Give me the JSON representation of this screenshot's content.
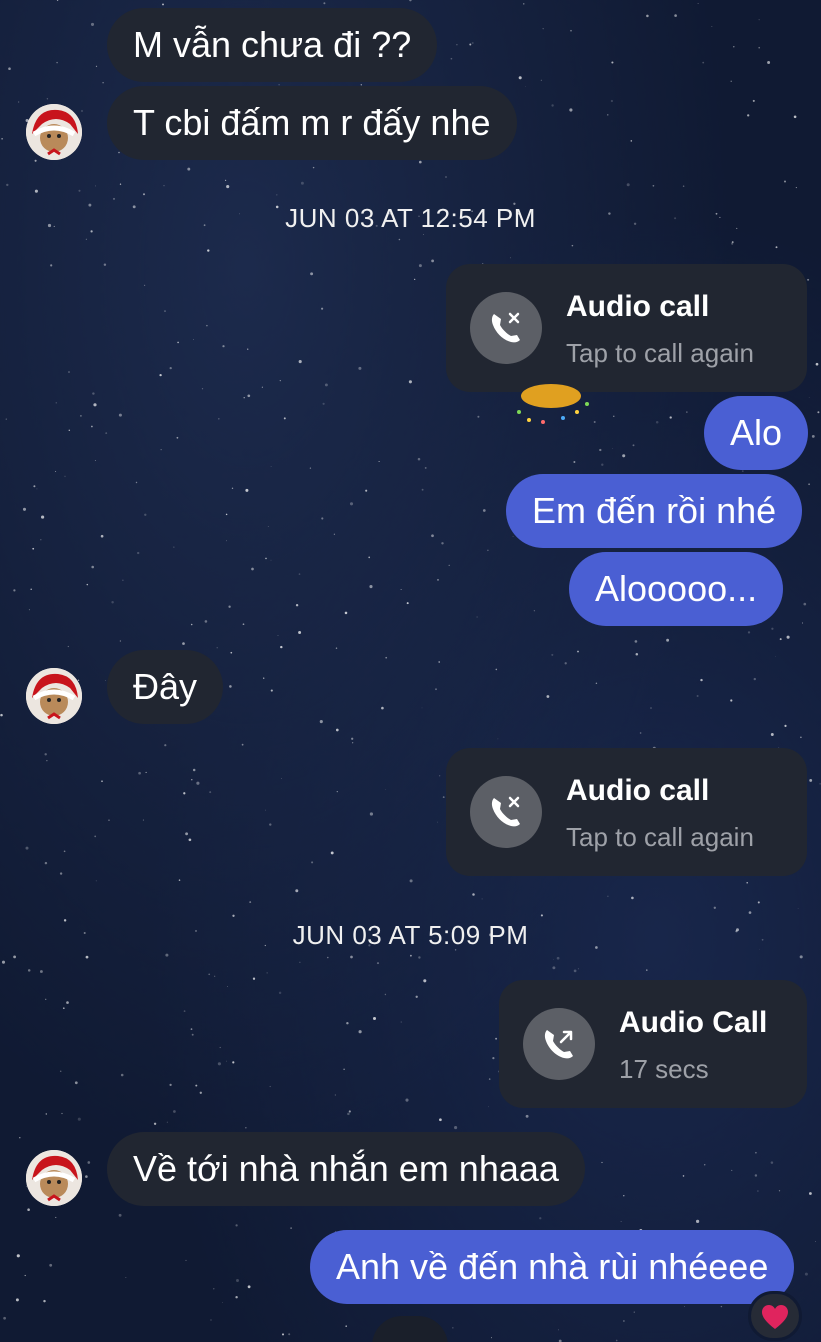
{
  "conversation": {
    "messages": [
      {
        "side": "in",
        "text": "M vẫn chưa đi ??"
      },
      {
        "side": "in",
        "text": "T cbi đấm m r đấy nhe"
      },
      {
        "side": "out",
        "text": "Alo"
      },
      {
        "side": "out",
        "text": "Em đến rồi nhé"
      },
      {
        "side": "out",
        "text": "Alooooo..."
      },
      {
        "side": "in",
        "text": "Đây"
      },
      {
        "side": "in",
        "text": "Về tới nhà nhắn em nhaaa"
      },
      {
        "side": "out",
        "text": "Anh về đến nhà rùi nhéeee",
        "reaction": "heart-icon"
      }
    ],
    "timestamps": [
      "JUN 03 AT 12:54 PM",
      "JUN 03 AT 5:09 PM"
    ],
    "calls": [
      {
        "title": "Audio call",
        "subtitle": "Tap to call again",
        "icon": "missed-call-icon"
      },
      {
        "title": "Audio call",
        "subtitle": "Tap to call again",
        "icon": "missed-call-icon"
      },
      {
        "title": "Audio Call",
        "subtitle": "17 secs",
        "icon": "outgoing-call-icon"
      }
    ]
  },
  "theme": {
    "incoming_bubble": "#212631",
    "outgoing_bubble": "#4a5fd3",
    "background": "#101a33",
    "reaction_color": "#e0245e"
  }
}
